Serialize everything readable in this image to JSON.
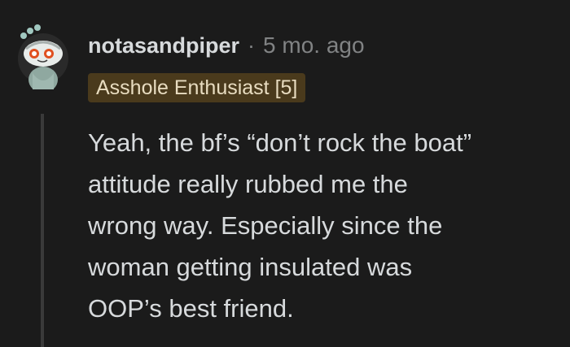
{
  "comment": {
    "username": "notasandpiper",
    "separator": "·",
    "timestamp": "5 mo. ago",
    "flair": "Asshole Enthusiast [5]",
    "body_lines": [
      "Yeah, the bf’s “don’t rock the boat”",
      "attitude really rubbed me the",
      "wrong way. Especially since the",
      "woman getting insulated was",
      "OOP’s best friend."
    ],
    "avatar_icon": "snoo-avatar-icon"
  },
  "colors": {
    "background": "#1b1b1b",
    "text": "#d7dadc",
    "muted": "#818384",
    "flair_bg": "#4a3a1c"
  }
}
